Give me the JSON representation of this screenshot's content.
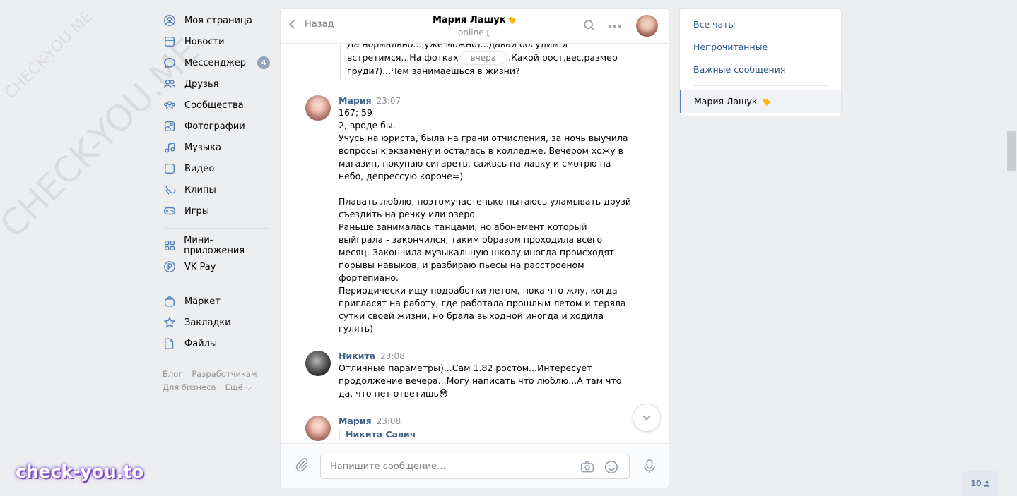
{
  "watermarks": {
    "small": "CHECK-YOU.ME",
    "large": "CHECK-YOU.ME",
    "brand": "check-you.to"
  },
  "nav": {
    "items": [
      {
        "label": "Моя страница",
        "icon": "user-circle-icon"
      },
      {
        "label": "Новости",
        "icon": "news-icon"
      },
      {
        "label": "Мессенджер",
        "icon": "chat-bubble-icon",
        "badge": "4"
      },
      {
        "label": "Друзья",
        "icon": "friends-icon"
      },
      {
        "label": "Сообщества",
        "icon": "groups-icon"
      },
      {
        "label": "Фотографии",
        "icon": "photo-icon"
      },
      {
        "label": "Музыка",
        "icon": "music-icon"
      },
      {
        "label": "Видео",
        "icon": "video-icon"
      },
      {
        "label": "Клипы",
        "icon": "clips-icon"
      },
      {
        "label": "Игры",
        "icon": "gamepad-icon"
      },
      {
        "label": "Мини-приложения",
        "icon": "apps-icon"
      },
      {
        "label": "VK Pay",
        "icon": "ruble-icon"
      },
      {
        "label": "Маркет",
        "icon": "bag-icon"
      },
      {
        "label": "Закладки",
        "icon": "star-icon"
      },
      {
        "label": "Файлы",
        "icon": "file-icon"
      }
    ],
    "footer": [
      "Блог",
      "Разработчикам",
      "Для бизнеса",
      "Ещё ⌵"
    ]
  },
  "chat": {
    "back_label": "Назад",
    "peer_name": "Мария Лашук",
    "peer_emoji": "🐤",
    "peer_status": "online ▯",
    "quote_lines": [
      "Да нормально...,уже можно)...давай обсудим и",
      "встретимся...На фотках",
      ".Какой рост,вес,размер",
      "груди?)...Чем занимаешься в жизни?"
    ],
    "date_pill": "вчера",
    "messages": [
      {
        "author": "Мария",
        "time": "23:07",
        "lines": [
          "167; 59",
          "2, вроде бы.",
          "Учусь на юриста, была на грани отчисления, за ночь выучила",
          "вопросы к экзамену и осталась в колледже. Вечером хожу в",
          "магазин, покупаю сигаретв, сажвсь на лавку и смотрю на",
          "небо, депрессую короче=)",
          "",
          "Плавать люблю, поэтомучастенько пытаюсь уламывать друзй",
          "съездить на речку или озеро",
          "Раньше занималась танцами, но абонемент который",
          "выйграла - закончился, таким образом проходила всего",
          "месяц. Закончила музыкальную школу иногда происходят",
          "порывы навыков, и разбираю пьесы на расстроеном",
          "фортепиано.",
          "Периодически ищу подработки летом, пока что жлу, когда",
          "пригласят на работу, где работала прошлым летом и теряла",
          "сутки своей жизни, но брала выходной иногда и ходила",
          "гулять)"
        ]
      },
      {
        "author": "Никита",
        "time": "23:08",
        "lines": [
          "Отличные параметры)...Сам 1.82 ростом...Интересует",
          "продолжение вечера...Могу написать что люблю...А там что",
          "да, что нет ответишь😳"
        ]
      },
      {
        "author": "Мария",
        "time": "23:08",
        "forward": "Никита Савич"
      }
    ],
    "composer_placeholder": "Напишите сообщение..."
  },
  "filters": {
    "items": [
      "Все чаты",
      "Непрочитанные",
      "Важные сообщения"
    ],
    "active_chat": "Мария Лашук",
    "active_chat_emoji": "🐤"
  },
  "online_count": "10"
}
